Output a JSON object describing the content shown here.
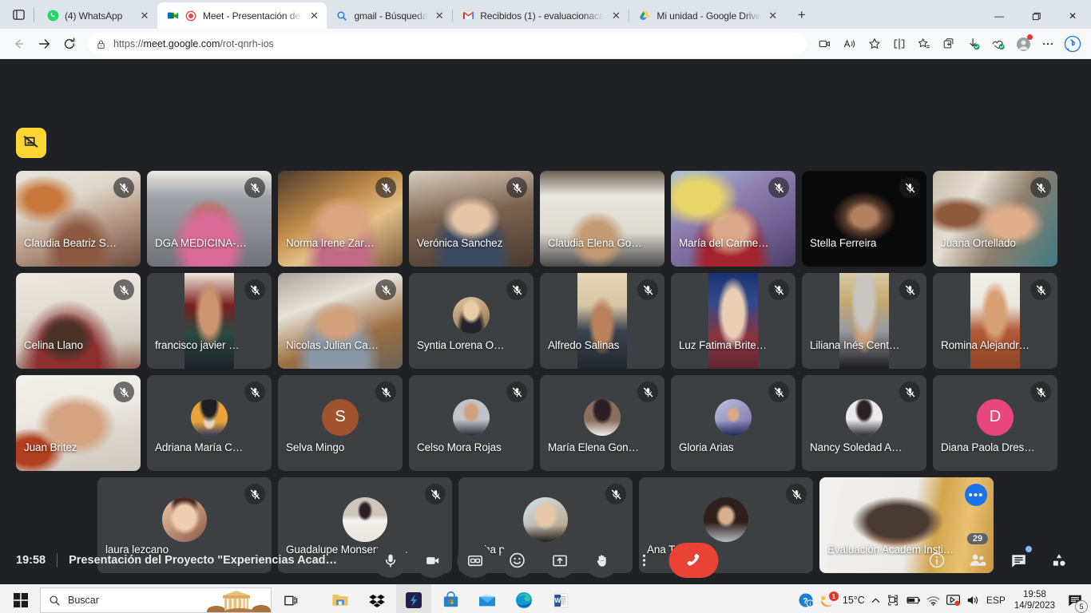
{
  "browser": {
    "tabs": [
      {
        "title": "(4) WhatsApp",
        "icon": "whatsapp-icon",
        "active": false
      },
      {
        "title": "Meet - Presentación del",
        "icon": "meet-icon",
        "active": true,
        "recording": true
      },
      {
        "title": "gmail - Búsqueda",
        "icon": "search-icon",
        "active": false
      },
      {
        "title": "Recibidos (1) - evaluacionaca",
        "icon": "gmail-icon",
        "active": false
      },
      {
        "title": "Mi unidad - Google Drive",
        "icon": "drive-icon",
        "active": false
      }
    ],
    "new_tab_label": "+",
    "close_label": "✕",
    "window_controls": {
      "minimize": "—",
      "maximize": "❐",
      "close": "✕"
    },
    "url_protocol": "https://",
    "url_host": "meet.google.com",
    "url_path": "/rot-qnrh-ios",
    "toolbar_icons": [
      "back-icon",
      "forward-icon",
      "reload-icon",
      "lock-icon",
      "video-capture-icon",
      "read-aloud-icon",
      "favorite-star-icon",
      "split-screen-icon",
      "collections-icon",
      "add-tab-group-icon",
      "downloads-icon",
      "performance-icon",
      "profile-icon",
      "settings-more-icon",
      "bing-copilot-icon"
    ]
  },
  "meet": {
    "share_badge": "presentation-off-icon",
    "time": "19:58",
    "title": "Presentación del Proyecto \"Experiencias Acad…",
    "participant_count": "29",
    "controls": [
      {
        "name": "microphone-button",
        "icon": "mic-icon"
      },
      {
        "name": "camera-button",
        "icon": "camera-icon"
      },
      {
        "name": "captions-button",
        "icon": "cc-icon"
      },
      {
        "name": "reactions-button",
        "icon": "emoji-icon"
      },
      {
        "name": "present-now-button",
        "icon": "present-screen-icon"
      },
      {
        "name": "raise-hand-button",
        "icon": "hand-icon"
      },
      {
        "name": "more-options-button",
        "icon": "three-dots-icon"
      },
      {
        "name": "leave-call-button",
        "icon": "hangup-icon"
      }
    ],
    "right_controls": [
      {
        "name": "meeting-details-button",
        "icon": "info-icon"
      },
      {
        "name": "show-everyone-button",
        "icon": "people-icon"
      },
      {
        "name": "chat-button",
        "icon": "chat-icon"
      },
      {
        "name": "activities-button",
        "icon": "activities-icon"
      }
    ],
    "rows": [
      [
        {
          "name": "Claudia Beatriz S…",
          "kind": "video",
          "muted": true,
          "bg": "claudia-beatriz-video"
        },
        {
          "name": "DGA MEDICINA-…",
          "kind": "video",
          "muted": true,
          "bg": "dga-medicina-video"
        },
        {
          "name": "Norma Irene Zar…",
          "kind": "video",
          "muted": true,
          "bg": "norma-irene-video"
        },
        {
          "name": "Verónica Sanchez",
          "kind": "video",
          "muted": true,
          "bg": "veronica-sanchez-video"
        },
        {
          "name": "Claudia Elena Go…",
          "kind": "video",
          "muted": false,
          "bg": "claudia-elena-video"
        },
        {
          "name": "María del Carme…",
          "kind": "video",
          "muted": true,
          "bg": "maria-del-carmen-video"
        },
        {
          "name": "Stella Ferreira",
          "kind": "video",
          "muted": true,
          "bg": "stella-ferreira-video"
        },
        {
          "name": "Juana Ortellado",
          "kind": "video",
          "muted": true,
          "bg": "juana-ortellado-video"
        }
      ],
      [
        {
          "name": "Celina Llano",
          "kind": "video",
          "muted": true,
          "bg": "celina-llano-video"
        },
        {
          "name": "francisco javier …",
          "kind": "video-narrow",
          "muted": true,
          "bg": "francisco-javier-video"
        },
        {
          "name": "Nicolas Julian Ca…",
          "kind": "video",
          "muted": true,
          "bg": "nicolas-julian-video"
        },
        {
          "name": "Syntia Lorena O…",
          "kind": "avatar",
          "muted": true,
          "avatar_color": "#c8a882",
          "initial": ""
        },
        {
          "name": "Alfredo Salinas",
          "kind": "video-narrow",
          "muted": true,
          "bg": "alfredo-salinas-video"
        },
        {
          "name": "Luz Fatima Brite…",
          "kind": "video-narrow",
          "muted": true,
          "bg": "luz-fatima-video"
        },
        {
          "name": "Liliana Inés Cent…",
          "kind": "video-narrow",
          "muted": true,
          "bg": "liliana-ines-video"
        },
        {
          "name": "Romina Alejandr…",
          "kind": "video-narrow",
          "muted": true,
          "bg": "romina-alejandra-video"
        }
      ],
      [
        {
          "name": "Juan Britez",
          "kind": "video",
          "muted": true,
          "bg": "juan-britez-video"
        },
        {
          "name": "Adriana María C…",
          "kind": "avatar",
          "muted": true,
          "avatar_color": "#e8a33d",
          "initial": ""
        },
        {
          "name": "Selva Mingo",
          "kind": "initial",
          "muted": true,
          "avatar_color": "#a0522d",
          "initial": "S"
        },
        {
          "name": "Celso Mora Rojas",
          "kind": "avatar",
          "muted": true,
          "avatar_color": "#c0c4c9",
          "initial": ""
        },
        {
          "name": "María Elena Gon…",
          "kind": "avatar",
          "muted": true,
          "avatar_color": "#8a6f5e",
          "initial": ""
        },
        {
          "name": "Gloria Arias",
          "kind": "avatar",
          "muted": true,
          "avatar_color": "#7a74a8",
          "initial": ""
        },
        {
          "name": "Nancy Soledad A…",
          "kind": "avatar",
          "muted": true,
          "avatar_color": "#e6e6e6",
          "initial": ""
        },
        {
          "name": "Diana Paola Dres…",
          "kind": "initial",
          "muted": true,
          "avatar_color": "#e8467c",
          "initial": "D"
        }
      ],
      [
        {
          "name": "laura lezcano",
          "kind": "avatar",
          "muted": true,
          "avatar_color": "#d8a98c",
          "initial": "",
          "wide": true
        },
        {
          "name": "Guadalupe Monserrat L…",
          "kind": "avatar",
          "muted": true,
          "avatar_color": "#cfc6bb",
          "initial": "",
          "wide": true
        },
        {
          "name": "mirtha pelozo",
          "kind": "avatar",
          "muted": true,
          "avatar_color": "#cbb79a",
          "initial": "",
          "wide": true
        },
        {
          "name": "Ana Talavera",
          "kind": "avatar",
          "muted": true,
          "avatar_color": "#4a3b33",
          "initial": "",
          "wide": true
        },
        {
          "name": "Evaluación Academ Insti…",
          "kind": "video",
          "muted": false,
          "self": true,
          "bg": "selfview-video",
          "wide": true
        }
      ]
    ]
  },
  "taskbar": {
    "start_icon": "windows-start-icon",
    "search_placeholder": "Buscar",
    "task_view_icon": "task-view-icon",
    "apps": [
      {
        "name": "file-explorer-icon",
        "running": true
      },
      {
        "name": "dropbox-icon",
        "running": false
      },
      {
        "name": "app-purple-icon",
        "running": true,
        "active": true
      },
      {
        "name": "microsoft-store-icon",
        "running": false
      },
      {
        "name": "mail-icon",
        "running": false
      },
      {
        "name": "microsoft-edge-icon",
        "running": true
      },
      {
        "name": "word-icon",
        "running": true
      }
    ],
    "tray": {
      "help_icon": "help-circle-icon",
      "weather_icon": "weather-icon",
      "weather_notice": "1",
      "temperature": "15°C",
      "overflow_icon": "chevron-up-icon",
      "meet_cam_icon": "camera-tray-icon",
      "battery_icon": "battery-charging-icon",
      "network_icon": "wifi-icon",
      "screen_share_icon": "screen-record-icon",
      "volume_icon": "speaker-icon",
      "language": "ESP",
      "clock_time": "19:58",
      "clock_date": "14/9/2023",
      "notification_icon": "notification-icon",
      "notification_count": "5"
    }
  },
  "colors": {
    "accent_blue": "#1a73e8",
    "self_outline": "#8ab4f8",
    "hangup_red": "#ea4335",
    "share_yellow": "#fdd633",
    "meet_bg": "#202124",
    "tile_bg": "#3c4043"
  }
}
